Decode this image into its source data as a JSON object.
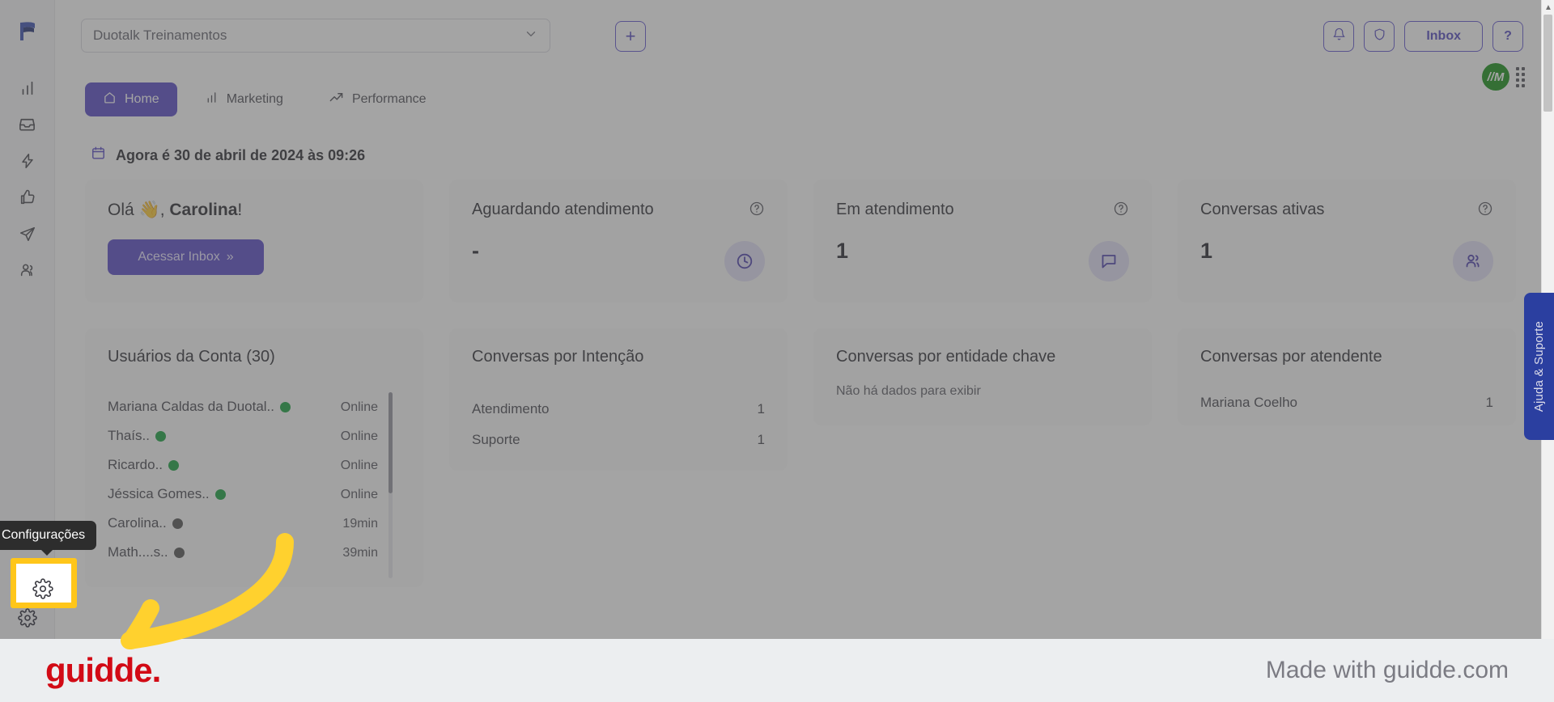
{
  "topbar": {
    "account_value": "Duotalk Treinamentos",
    "add_label": "+",
    "inbox_label": "Inbox",
    "help_label": "?",
    "avatar_initials": "//M",
    "bell_icon": "bell-icon",
    "shield_icon": "shield-icon",
    "chevron_icon": "chevron-down-icon",
    "grip_icon": "grip-dots-icon"
  },
  "sidebar": {
    "logo": "duotalk-flag-logo",
    "items": [
      {
        "name": "analytics",
        "icon": "bar-chart-icon"
      },
      {
        "name": "inbox",
        "icon": "inbox-icon"
      },
      {
        "name": "automations",
        "icon": "bolt-icon"
      },
      {
        "name": "feedback",
        "icon": "thumbs-up-icon"
      },
      {
        "name": "campaigns",
        "icon": "paper-plane-icon"
      },
      {
        "name": "contacts",
        "icon": "users-icon"
      }
    ],
    "bottom": [
      {
        "name": "profile",
        "icon": "user-icon"
      },
      {
        "name": "settings",
        "icon": "gear-icon"
      }
    ],
    "settings_tooltip": "Configurações"
  },
  "tabs": [
    {
      "label": "Home",
      "icon": "home-icon",
      "active": true
    },
    {
      "label": "Marketing",
      "icon": "bar-chart-icon",
      "active": false
    },
    {
      "label": "Performance",
      "icon": "trend-up-icon",
      "active": false
    }
  ],
  "dateline": {
    "icon": "calendar-icon",
    "text": "Agora é 30 de abril de 2024 às 09:26"
  },
  "hello_card": {
    "greeting_prefix": "Olá",
    "wave_emoji": "👋",
    "comma": ",",
    "name": "Carolina",
    "exclam": "!",
    "button_label": "Acessar Inbox",
    "button_chevrons": "»"
  },
  "stats": [
    {
      "title": "Aguardando atendimento",
      "value": "-",
      "badge_icon": "clock-icon",
      "help_icon": "question-circle-icon"
    },
    {
      "title": "Em atendimento",
      "value": "1",
      "badge_icon": "chat-bubble-icon",
      "help_icon": "question-circle-icon"
    },
    {
      "title": "Conversas ativas",
      "value": "1",
      "badge_icon": "users-icon",
      "help_icon": "question-circle-icon"
    }
  ],
  "users_card": {
    "title": "Usuários da Conta (30)",
    "rows": [
      {
        "name": "Mariana Caldas da Duotal..",
        "status_dot": "online",
        "status": "Online"
      },
      {
        "name": "Thaís..",
        "status_dot": "online",
        "status": "Online"
      },
      {
        "name": "Ricardo..",
        "status_dot": "online",
        "status": "Online"
      },
      {
        "name": "Jéssica Gomes..",
        "status_dot": "online",
        "status": "Online"
      },
      {
        "name": "Carolina..",
        "status_dot": "offline",
        "status": "19min"
      },
      {
        "name": "Math....s..",
        "status_dot": "offline",
        "status": "39min"
      }
    ]
  },
  "intent_card": {
    "title": "Conversas por Intenção",
    "rows": [
      {
        "label": "Atendimento",
        "value": "1"
      },
      {
        "label": "Suporte",
        "value": "1"
      }
    ]
  },
  "entity_card": {
    "title": "Conversas por entidade chave",
    "empty": "Não há dados para exibir"
  },
  "agent_card": {
    "title": "Conversas por atendente",
    "rows": [
      {
        "label": "Mariana Coelho",
        "value": "1"
      }
    ]
  },
  "help_tab": {
    "label": "Ajuda & Suporte"
  },
  "footer": {
    "logo": "guidde.",
    "made_with": "Made with guidde.com"
  },
  "colors": {
    "primary": "#4f3fc4",
    "primary_border": "#5b4fcf",
    "online": "#0a9b33",
    "offline": "#4a4a4a",
    "help_tab": "#2b3fa0",
    "guidde_red": "#d20a15",
    "highlight_yellow": "#ffc61a",
    "avatar_green": "#0a8a0a"
  }
}
